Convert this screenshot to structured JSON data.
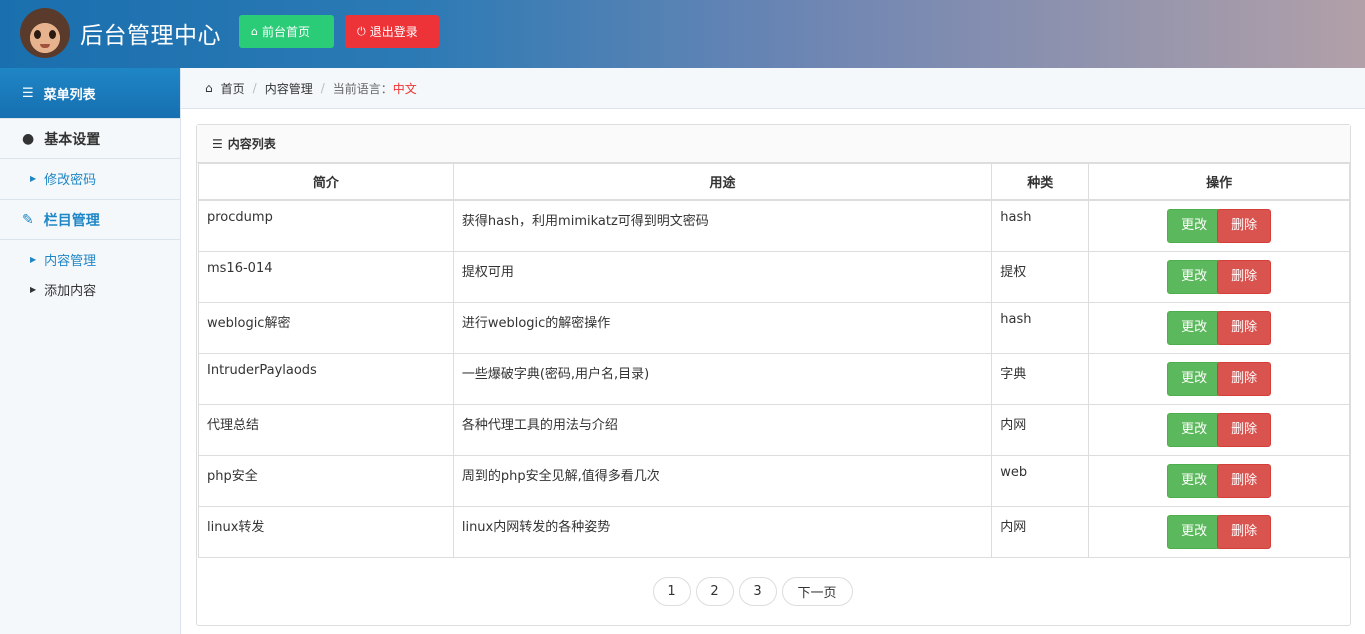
{
  "header": {
    "title": "后台管理中心",
    "home_button": "前台首页",
    "logout_button": "退出登录"
  },
  "sidebar": {
    "menu_title": "菜单列表",
    "section_basic": "基本设置",
    "change_password": "修改密码",
    "section_column": "栏目管理",
    "content_manage": "内容管理",
    "add_content": "添加内容"
  },
  "breadcrumb": {
    "home": "首页",
    "current": "内容管理",
    "lang_label": "当前语言：",
    "lang_value": "中文"
  },
  "panel": {
    "title": "内容列表",
    "columns": [
      "简介",
      "用途",
      "种类",
      "操作"
    ],
    "edit_label": "更改",
    "delete_label": "删除",
    "rows": [
      {
        "name": "procdump",
        "usage": "获得hash，利用mimikatz可得到明文密码",
        "kind": "hash"
      },
      {
        "name": "ms16-014",
        "usage": "提权可用",
        "kind": "提权"
      },
      {
        "name": "weblogic解密",
        "usage": "进行weblogic的解密操作",
        "kind": "hash"
      },
      {
        "name": "IntruderPaylaods",
        "usage": "一些爆破字典(密码,用户名,目录)",
        "kind": "字典"
      },
      {
        "name": "代理总结",
        "usage": "各种代理工具的用法与介绍",
        "kind": "内网"
      },
      {
        "name": "php安全",
        "usage": "周到的php安全见解,值得多看几次",
        "kind": "web"
      },
      {
        "name": "linux转发",
        "usage": "linux内网转发的各种姿势",
        "kind": "内网"
      }
    ]
  },
  "pagination": {
    "pages": [
      "1",
      "2",
      "3"
    ],
    "next": "下一页"
  },
  "colors": {
    "accent": "#1f86c6",
    "success": "#5cb85c",
    "danger": "#d9534f",
    "home_button": "#2bcc77",
    "logout_button": "#ee3338"
  },
  "icons": [
    "home-icon",
    "power-icon",
    "list-icon",
    "user-icon",
    "edit-icon",
    "caret-right-icon"
  ]
}
